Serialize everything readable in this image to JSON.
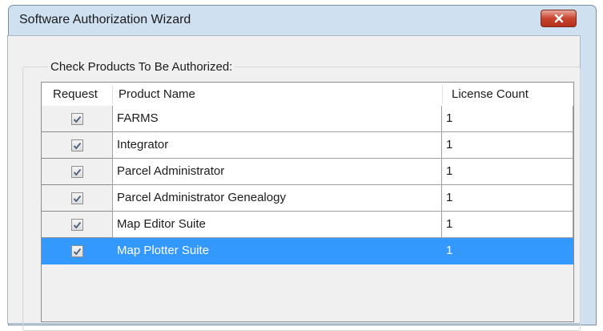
{
  "window": {
    "title": "Software Authorization Wizard",
    "close_icon": "close-icon"
  },
  "group": {
    "label": "Check Products To Be Authorized:"
  },
  "table": {
    "columns": [
      "Request",
      "Product Name",
      "License Count"
    ],
    "rows": [
      {
        "checked": true,
        "product": "FARMS",
        "count": "1",
        "selected": false
      },
      {
        "checked": true,
        "product": "Integrator",
        "count": "1",
        "selected": false
      },
      {
        "checked": true,
        "product": "Parcel Administrator",
        "count": "1",
        "selected": false
      },
      {
        "checked": true,
        "product": "Parcel Administrator Genealogy",
        "count": "1",
        "selected": false
      },
      {
        "checked": true,
        "product": "Map Editor Suite",
        "count": "1",
        "selected": false
      },
      {
        "checked": true,
        "product": "Map Plotter Suite",
        "count": "1",
        "selected": true
      }
    ]
  },
  "colors": {
    "selection": "#3399ff",
    "close_button": "#c8442e",
    "check_mark": "#4a5f80"
  }
}
